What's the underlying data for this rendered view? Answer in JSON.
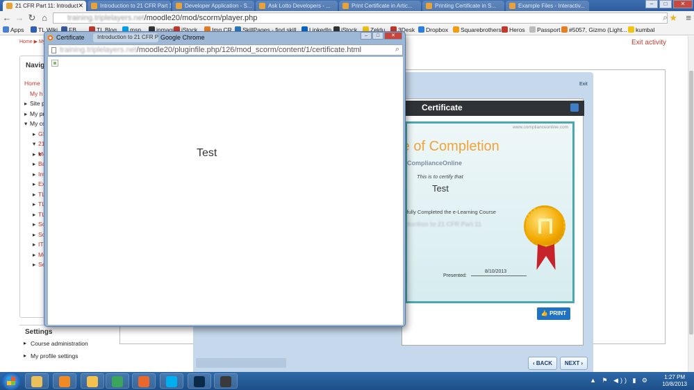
{
  "browser": {
    "tabs": [
      {
        "label": "21 CFR Part 11: Introduct"
      },
      {
        "label": "Introduction to 21 CFR Part 11: I"
      },
      {
        "label": "Developer Application - S..."
      },
      {
        "label": "Ask Lotto Developers - ..."
      },
      {
        "label": "Print Certificate in Artic..."
      },
      {
        "label": "Printing Certificate in S..."
      },
      {
        "label": "Example Files - Interactiv..."
      }
    ],
    "url": {
      "blurred": "training.triplelayers.net",
      "path": "/moodle20/mod/scorm/player.php"
    },
    "bookmarks": [
      {
        "label": "Apps",
        "color": "#4a7fd4"
      },
      {
        "label": "TL Wiki",
        "color": "#2f5fb3"
      },
      {
        "label": "FB",
        "color": "#3b5998"
      },
      {
        "label": "TL Blog",
        "color": "#c0392b"
      },
      {
        "label": "msn",
        "color": "#00a2ed"
      },
      {
        "label": "inmagine",
        "color": "#333333"
      },
      {
        "label": "iStock",
        "color": "#c0392b"
      },
      {
        "label": "Img CR",
        "color": "#e67e22"
      },
      {
        "label": "SkillPages - find skill...",
        "color": "#2a7ab8"
      },
      {
        "label": "LinkedIn",
        "color": "#0a66c2"
      },
      {
        "label": "iStock",
        "color": "#333333"
      },
      {
        "label": "Zeldu",
        "color": "#f1c40f"
      },
      {
        "label": "3Desk",
        "color": "#c0392b"
      },
      {
        "label": "Dropbox",
        "color": "#2a7de1"
      },
      {
        "label": "Squarebrothers",
        "color": "#f39c12"
      },
      {
        "label": "Heros",
        "color": "#c0392b"
      },
      {
        "label": "Passport",
        "color": "#bbbbbb"
      },
      {
        "label": "#5057, Gizmo (Light...",
        "color": "#e67e22"
      },
      {
        "label": "kumbal",
        "color": "#f1c40f"
      }
    ]
  },
  "moodle": {
    "breadcrumb": "Home ▶ My",
    "exit_activity": "Exit activity",
    "navigation": {
      "heading": "Navig",
      "items": [
        {
          "label": "Home"
        },
        {
          "label": "My h"
        },
        {
          "label": "Site p"
        },
        {
          "label": "My pr"
        },
        {
          "label": "My co"
        },
        {
          "label": "GS"
        },
        {
          "label": "21"
        },
        {
          "label": ""
        },
        {
          "label": ""
        },
        {
          "label": "Mo"
        },
        {
          "label": "Ba"
        },
        {
          "label": "Int"
        },
        {
          "label": "Ex"
        },
        {
          "label": "TL"
        },
        {
          "label": "TL"
        },
        {
          "label": "TL"
        },
        {
          "label": "So"
        },
        {
          "label": "So"
        },
        {
          "label": "ITI"
        },
        {
          "label": "Mo"
        },
        {
          "label": "Se"
        }
      ]
    },
    "settings": {
      "heading": "Settings",
      "items": [
        {
          "label": "Course administration"
        },
        {
          "label": "My profile settings"
        }
      ]
    }
  },
  "scorm": {
    "exit_label": "Exit",
    "certificate_header": "Certificate",
    "certificate": {
      "site": "www.complianceonline.com",
      "title": "ate of Completion",
      "org": "ComplianceOnline",
      "certify_text": "This is to certify that",
      "name": "Test",
      "completed_text": "ssfully Completed the e-Learning Course",
      "course": "duction to 21 CFR Part 11",
      "presented_label": "Presented:",
      "date": "8/10/2013"
    },
    "print_label": "PRINT",
    "back_label": "‹ BACK",
    "next_label": "NEXT ›"
  },
  "popup": {
    "tab_label": "Certificate",
    "secondary_tab": "Introduction to 21 CFR Part 11",
    "app_name": "Google Chrome",
    "url": {
      "blurred": "training.triplelayers.net",
      "path": "/moodle20/pluginfile.php/126/mod_scorm/content/1/certificate.html"
    },
    "content_text": "Test"
  },
  "taskbar": {
    "apps": [
      {
        "name": "file-explorer-icon",
        "color": "#e9c05a"
      },
      {
        "name": "media-player-icon",
        "color": "#f08a24"
      },
      {
        "name": "folder-icon",
        "color": "#f2c14e"
      },
      {
        "name": "chrome-icon",
        "color": "#3ba55c"
      },
      {
        "name": "firefox-icon",
        "color": "#e8692b"
      },
      {
        "name": "skype-icon",
        "color": "#00aff0"
      },
      {
        "name": "photoshop-icon",
        "color": "#0b2a4a"
      },
      {
        "name": "articulate-icon",
        "color": "#3a3a3a"
      }
    ],
    "time": "1:27 PM",
    "date": "10/8/2013"
  }
}
